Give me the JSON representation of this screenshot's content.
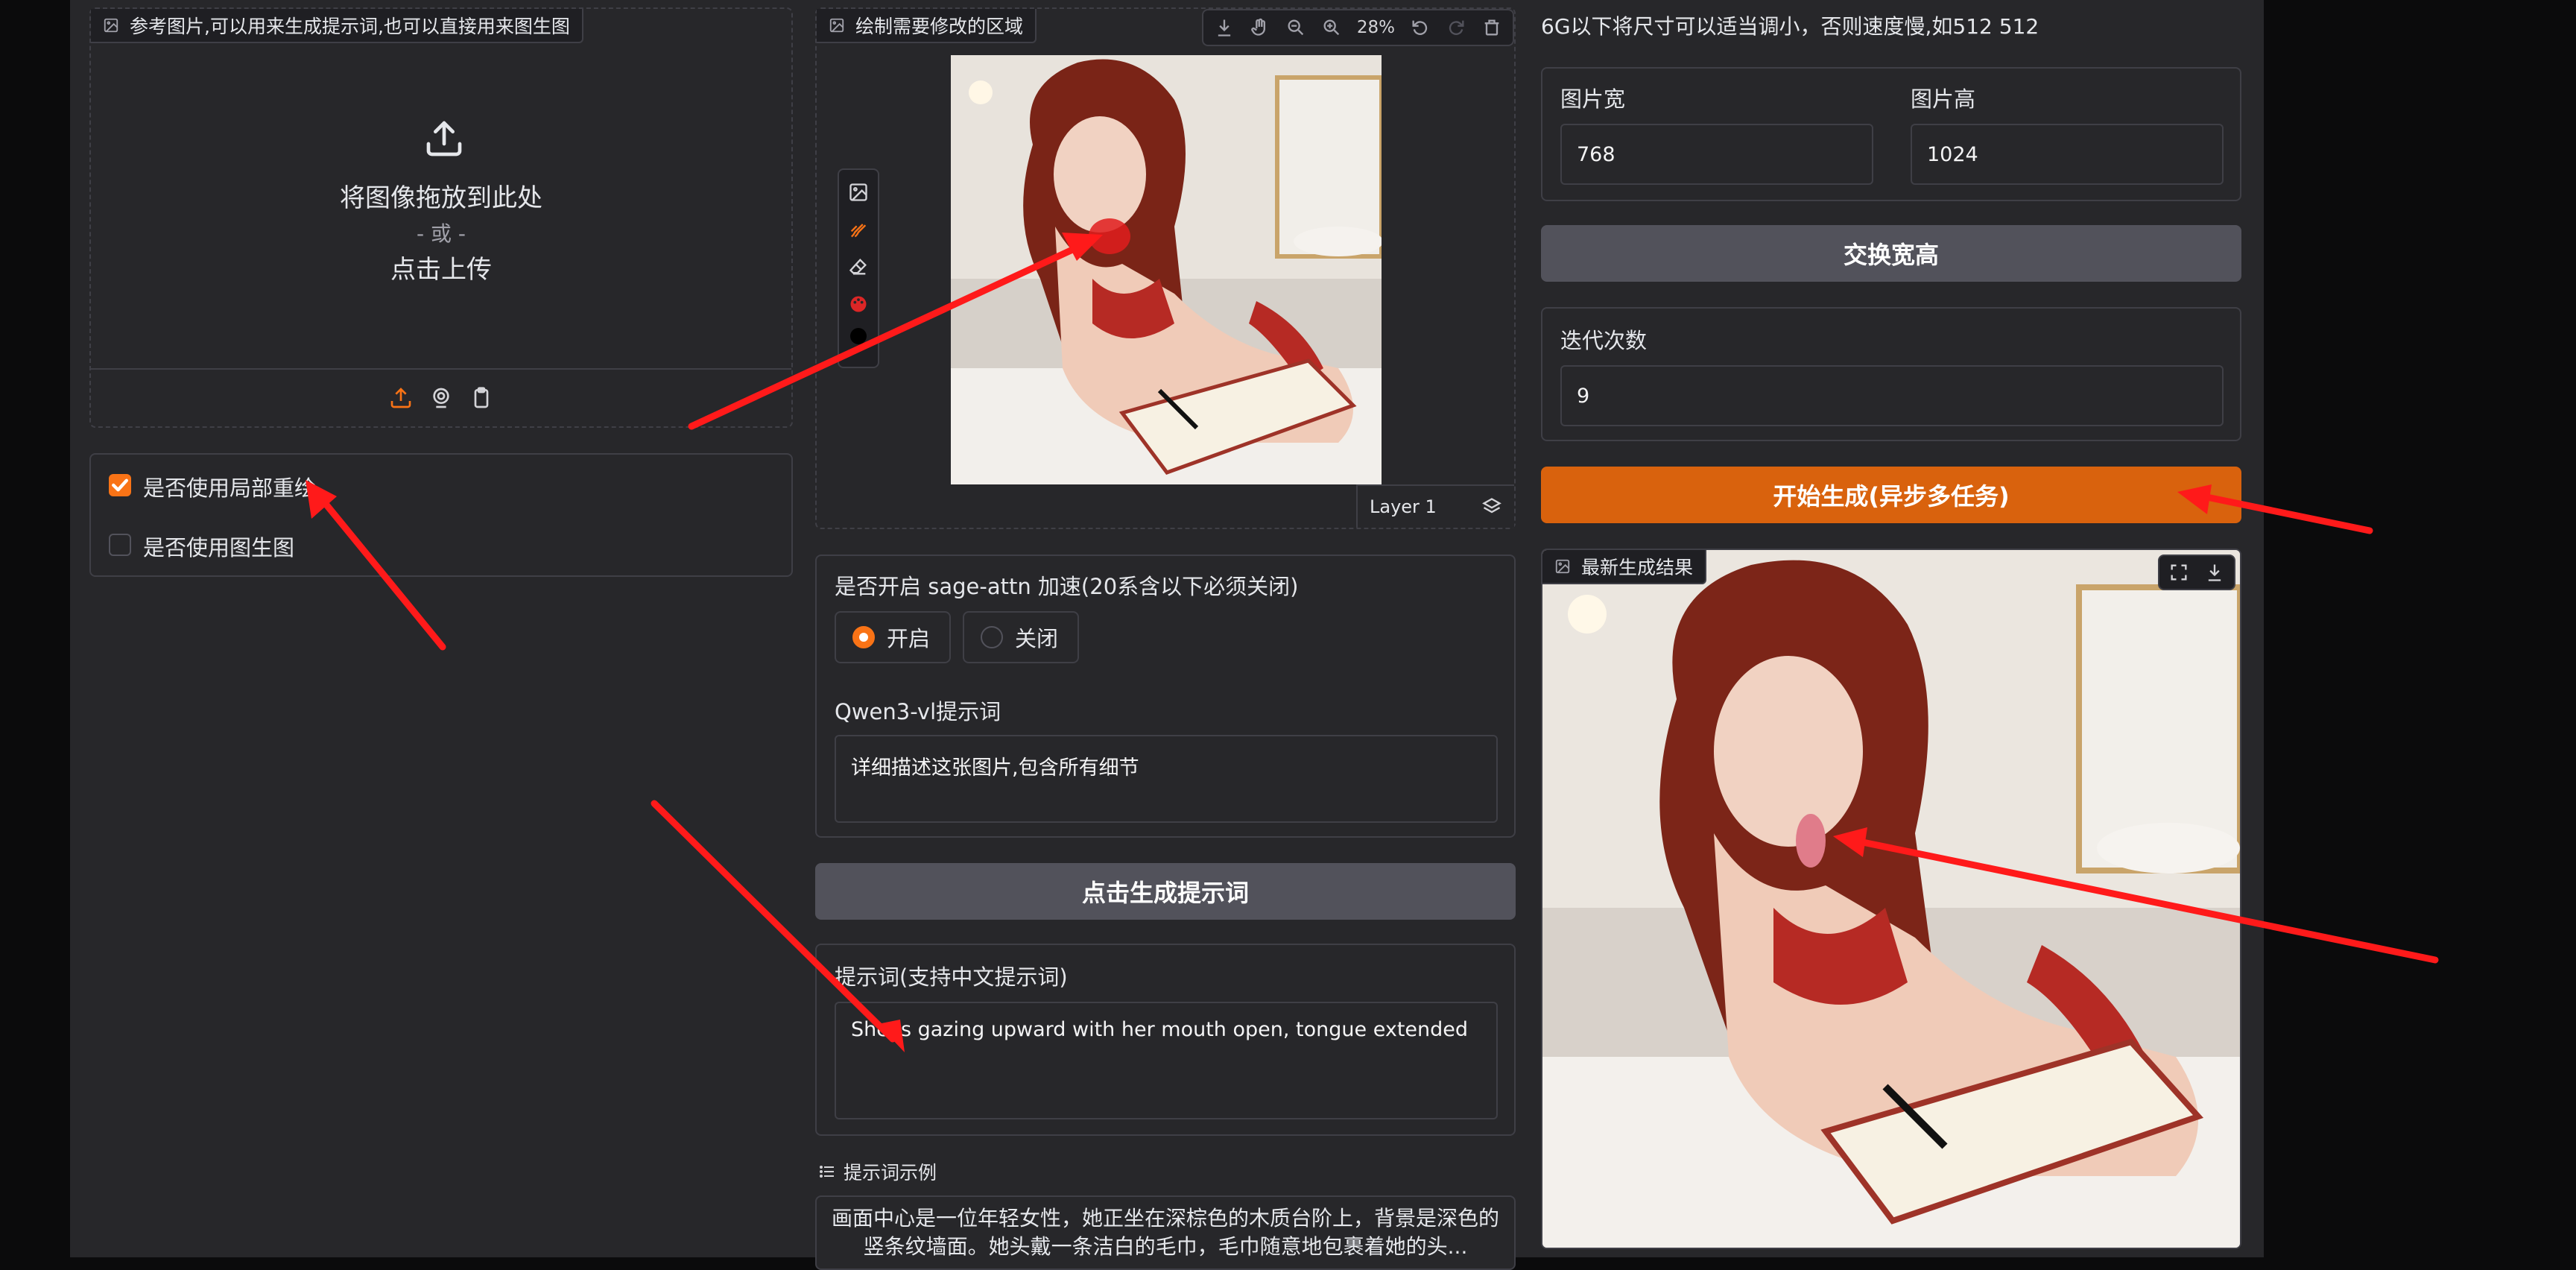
{
  "reference_image": {
    "label": "参考图片,可以用来生成提示词,也可以直接用来图生图",
    "drop_text": "将图像拖放到此处",
    "or_text": "- 或 -",
    "click_text": "点击上传"
  },
  "options": {
    "inpaint_label": "是否使用局部重绘",
    "inpaint_checked": true,
    "img2img_label": "是否使用图生图",
    "img2img_checked": false
  },
  "mask_editor": {
    "label": "绘制需要修改的区域",
    "zoom": "28%",
    "layer": "Layer 1",
    "brush_color": "#e11d1d"
  },
  "sage_attn": {
    "label": "是否开启 sage-attn 加速(20系含以下必须关闭)",
    "options": [
      "开启",
      "关闭"
    ],
    "selected": "开启"
  },
  "qwen": {
    "label": "Qwen3-vl提示词",
    "value": "详细描述这张图片,包含所有细节"
  },
  "gen_prompt_button": "点击生成提示词",
  "prompt": {
    "label": "提示词(支持中文提示词)",
    "value": "She is gazing upward with her mouth open, tongue extended"
  },
  "examples": {
    "label": "提示词示例",
    "text": "画面中心是一位年轻女性，她正坐在深棕色的木质台阶上，背景是深色的竖条纹墙面。她头戴一条洁白的毛巾，毛巾随意地包裹着她的头..."
  },
  "size_hint": "6G以下将尺寸可以适当调小，否则速度慢,如512 512",
  "width": {
    "label": "图片宽",
    "value": "768"
  },
  "height": {
    "label": "图片高",
    "value": "1024"
  },
  "swap_button": "交换宽高",
  "steps": {
    "label": "迭代次数",
    "value": "9"
  },
  "start_button": "开始生成(异步多任务)",
  "result": {
    "label": "最新生成结果"
  },
  "colors": {
    "accent": "#f97316",
    "start_button": "#d9620d",
    "gray_button": "#52525b",
    "annotation_arrow": "#ff1a1a"
  }
}
